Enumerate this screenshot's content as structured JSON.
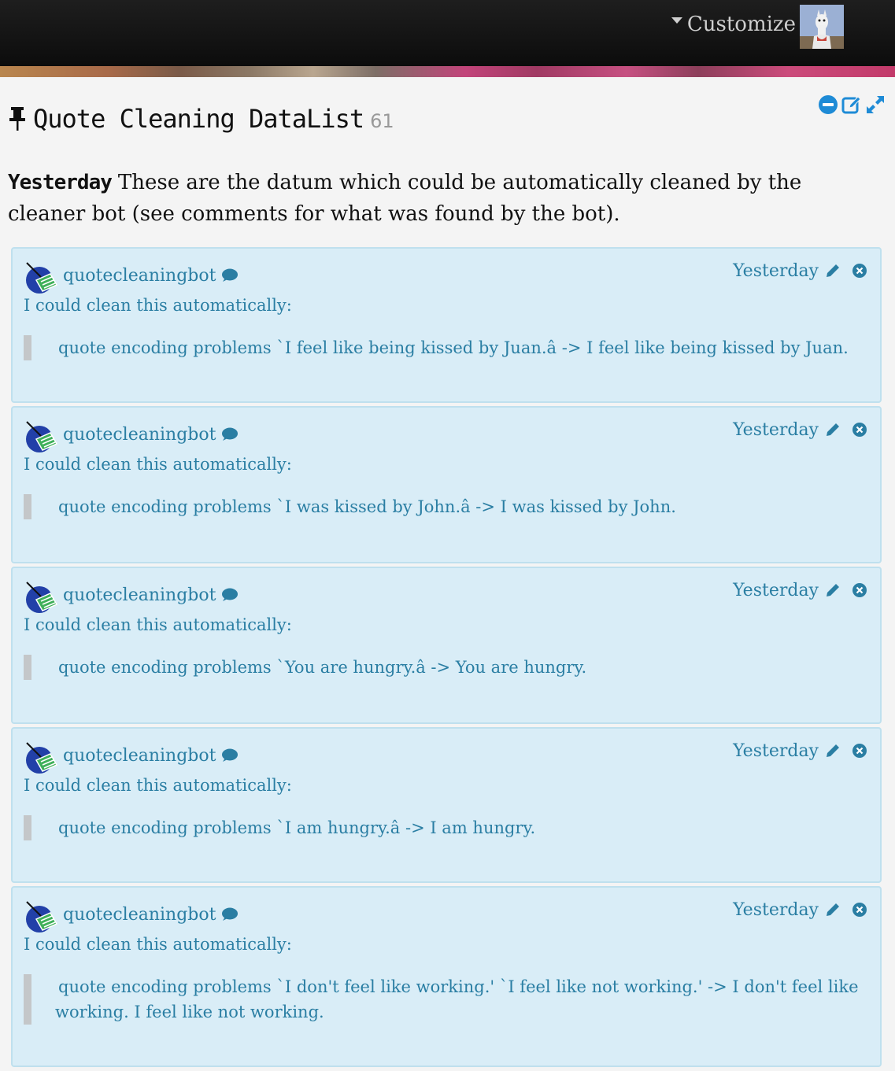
{
  "header": {
    "customize_label": "Customize"
  },
  "page": {
    "title": "Quote Cleaning DataList",
    "count": "61",
    "when": "Yesterday",
    "description": "These are the datum which could be automatically cleaned by the cleaner bot (see comments for what was found by the bot)."
  },
  "comments": [
    {
      "author": "quotecleaningbot",
      "time": "Yesterday",
      "intro": "I could clean this automatically:",
      "quote": "quote encoding problems `I feel like being kissed by Juan.â -> I feel like being kissed by Juan."
    },
    {
      "author": "quotecleaningbot",
      "time": "Yesterday",
      "intro": "I could clean this automatically:",
      "quote": "quote encoding problems `I was kissed by John.â -> I was kissed by John."
    },
    {
      "author": "quotecleaningbot",
      "time": "Yesterday",
      "intro": "I could clean this automatically:",
      "quote": "quote encoding problems `You are hungry.â -> You are hungry."
    },
    {
      "author": "quotecleaningbot",
      "time": "Yesterday",
      "intro": "I could clean this automatically:",
      "quote": "quote encoding problems `I am hungry.â -> I am hungry."
    },
    {
      "author": "quotecleaningbot",
      "time": "Yesterday",
      "intro": "I could clean this automatically:",
      "quote": "quote encoding problems `I don't feel like working.' `I feel like not working.' -> I don't feel like working. I feel like not working."
    }
  ],
  "colors": {
    "accent": "#2a7ea3",
    "icon_blue": "#1e8bd6",
    "comment_bg": "#d9edf7"
  },
  "icons": {
    "collapse": "minus-circle-icon",
    "edit_list": "edit-icon",
    "expand": "expand-icon",
    "pin": "pin-icon",
    "chat": "chat-bubble-icon",
    "edit_comment": "pencil-icon",
    "delete_comment": "close-circle-icon"
  }
}
